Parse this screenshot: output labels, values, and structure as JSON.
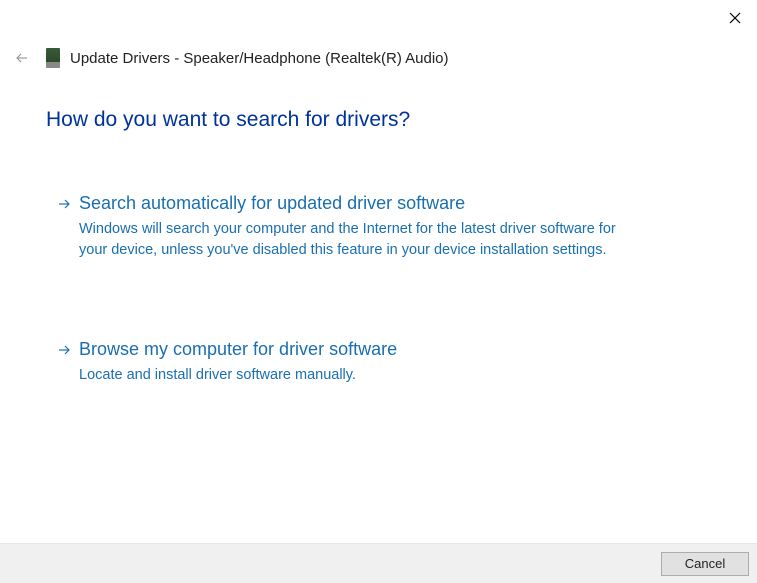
{
  "header": {
    "title": "Update Drivers - Speaker/Headphone (Realtek(R) Audio)"
  },
  "question": "How do you want to search for drivers?",
  "options": [
    {
      "title": "Search automatically for updated driver software",
      "desc": "Windows will search your computer and the Internet for the latest driver software for your device, unless you've disabled this feature in your device installation settings."
    },
    {
      "title": "Browse my computer for driver software",
      "desc": "Locate and install driver software manually."
    }
  ],
  "footer": {
    "cancel_label": "Cancel"
  }
}
